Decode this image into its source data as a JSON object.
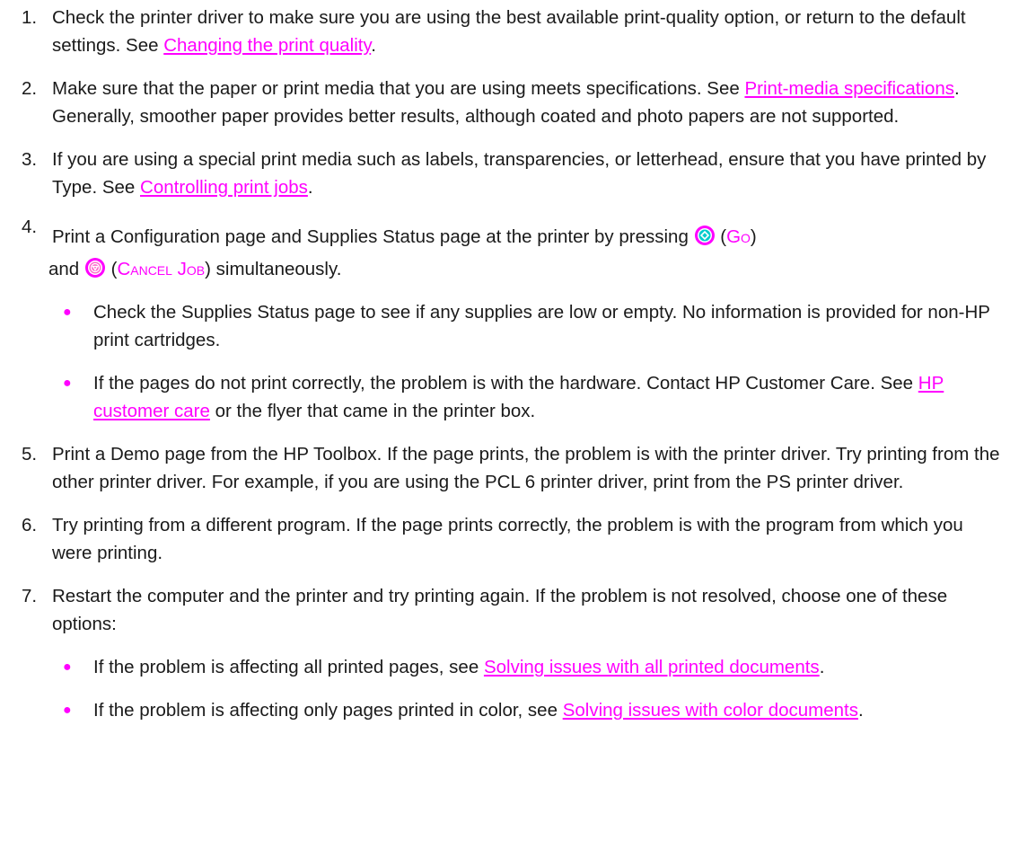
{
  "colors": {
    "link": "#ff00ff",
    "text": "#1a1a1a",
    "button_outer": "#ff00ff",
    "go_inner": "#00cccc",
    "cancel_inner": "#ff66cc"
  },
  "steps": [
    {
      "number": "1.",
      "text_before": "Check the printer driver to make sure you are using the best available print-quality option, or return to the default settings. See ",
      "link": "Changing the print quality",
      "text_after": "."
    },
    {
      "number": "2.",
      "text_before": "Make sure that the paper or print media that you are using meets specifications. See ",
      "link": "Print-media specifications",
      "text_after": ". Generally, smoother paper provides better results, although coated and photo papers are not supported."
    },
    {
      "number": "3.",
      "text_before": "If you are using a special print media such as labels, transparencies, or letterhead, ensure that you have printed by Type. See ",
      "link": "Controlling print jobs",
      "text_after": "."
    },
    {
      "number": "4.",
      "text_before": "Print a Configuration page and Supplies Status page at the printer by pressing ",
      "go_icon": "go-button-icon",
      "go_open": " (",
      "go_label": "Go",
      "go_close": ")",
      "and": " and ",
      "cancel_icon": "cancel-job-button-icon",
      "cancel_open": " (",
      "cancel_label": "Cancel Job",
      "cancel_close": ")",
      "text_after": " simultaneously.",
      "bullets": [
        {
          "text": "Check the Supplies Status page to see if any supplies are low or empty. No information is provided for non-HP print cartridges."
        },
        {
          "text_before": "If the pages do not print correctly, the problem is with the hardware. Contact HP Customer Care. See ",
          "link": "HP customer care",
          "text_after": " or the flyer that came in the printer box."
        }
      ]
    },
    {
      "number": "5.",
      "text": "Print a Demo page from the HP Toolbox. If the page prints, the problem is with the printer driver. Try printing from the other printer driver. For example, if you are using the PCL 6 printer driver, print from the PS printer driver."
    },
    {
      "number": "6.",
      "text": "Try printing from a different program. If the page prints correctly, the problem is with the program from which you were printing."
    },
    {
      "number": "7.",
      "text": "Restart the computer and the printer and try printing again. If the problem is not resolved, choose one of these options:",
      "bullets": [
        {
          "text_before": "If the problem is affecting all printed pages, see ",
          "link": "Solving issues with all printed documents",
          "text_after": "."
        },
        {
          "text_before": "If the problem is affecting only pages printed in color, see ",
          "link": "Solving issues with color documents",
          "text_after": "."
        }
      ]
    }
  ]
}
